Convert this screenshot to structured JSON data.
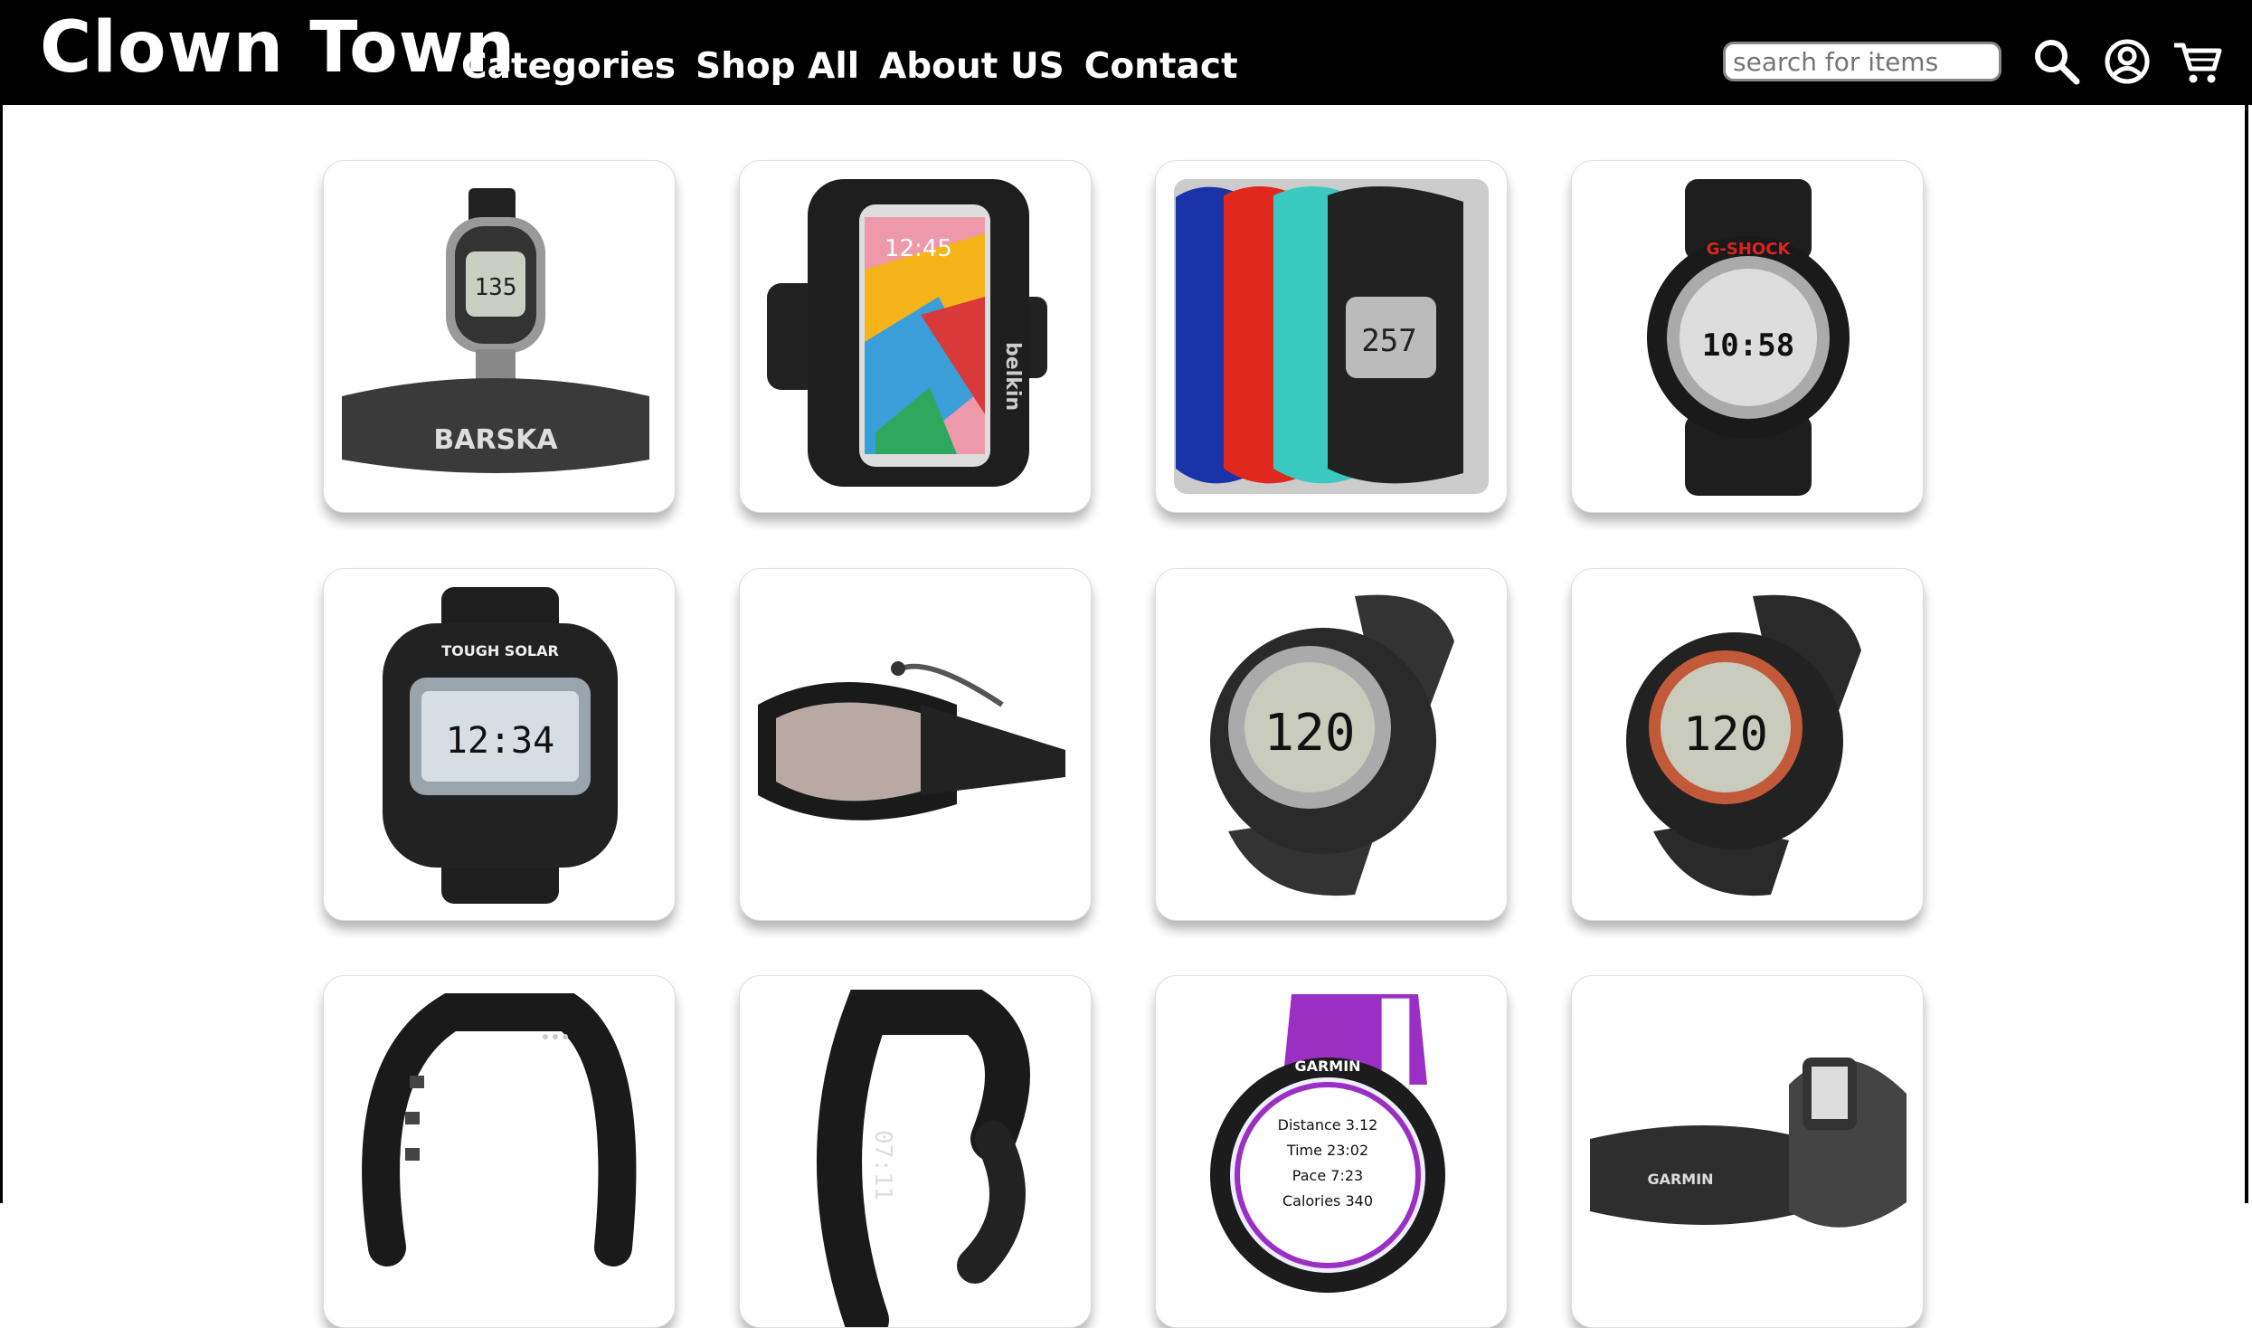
{
  "header": {
    "brand": "Clown Town",
    "nav": [
      "Categories",
      "Shop All",
      "About US",
      "Contact"
    ],
    "search_placeholder": "search for items"
  },
  "icons": [
    "search-icon",
    "account-icon",
    "cart-icon"
  ],
  "products": [
    {
      "id": "p1",
      "icon": "barska-heart-monitor-watch"
    },
    {
      "id": "p2",
      "icon": "belkin-phone-armband"
    },
    {
      "id": "p3",
      "icon": "colorful-sport-watches"
    },
    {
      "id": "p4",
      "icon": "g-shock-watch"
    },
    {
      "id": "p5",
      "icon": "casio-tough-solar-watch"
    },
    {
      "id": "p6",
      "icon": "swim-goggles"
    },
    {
      "id": "p7",
      "icon": "heart-rate-watch"
    },
    {
      "id": "p8",
      "icon": "heart-rate-watch-orange"
    },
    {
      "id": "p9",
      "icon": "fitness-band"
    },
    {
      "id": "p10",
      "icon": "bracelet-watch"
    },
    {
      "id": "p11",
      "icon": "garmin-purple-watch"
    },
    {
      "id": "p12",
      "icon": "garmin-chest-strap-watch"
    }
  ],
  "product_texts": {
    "barska": "BARSKA",
    "belkin": "belkin",
    "phone_time": "12:45",
    "gshock": "G-SHOCK",
    "gshock_time": "10:58",
    "casio_time": "12:34",
    "casio_brand": "TOUGH SOLAR",
    "hr_value": "120",
    "garmin": "GARMIN",
    "garmin_dist": "Distance 3.12",
    "garmin_time": "Time 23:02",
    "garmin_pace": "Pace 7:23",
    "garmin_cal": "Calories 340"
  }
}
